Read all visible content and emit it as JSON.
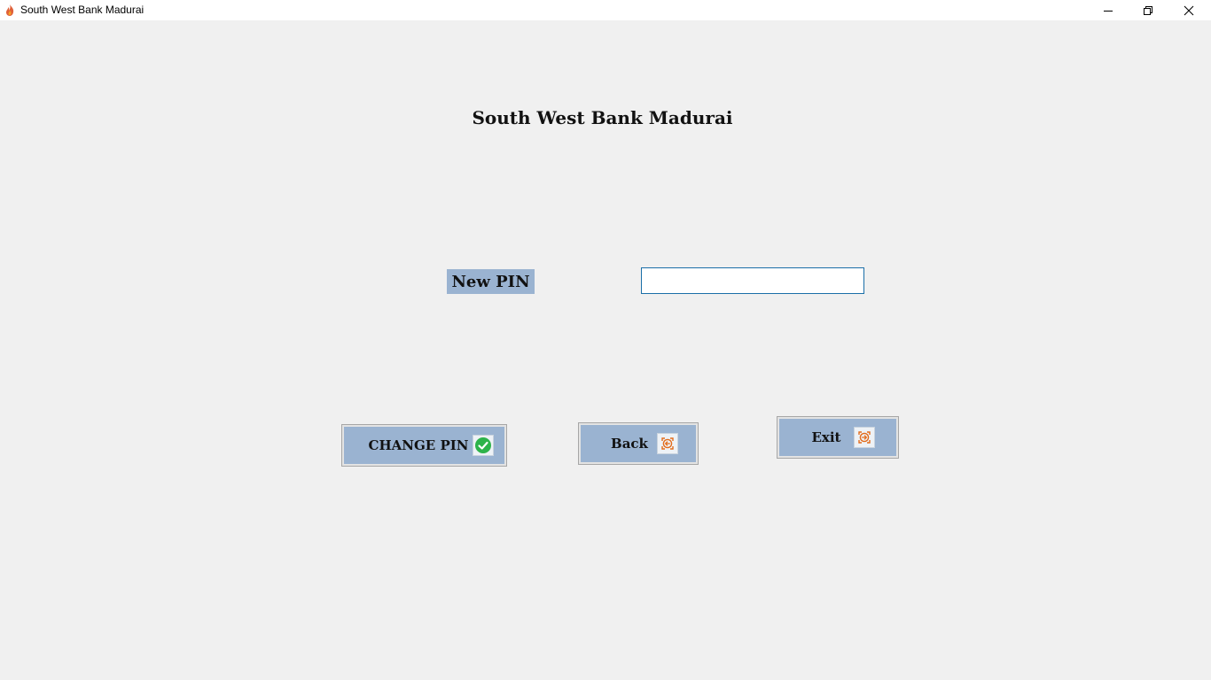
{
  "window": {
    "title": "South West Bank Madurai",
    "app_icon": "flame-app-icon",
    "controls": [
      "minimize-icon",
      "restore-icon",
      "close-icon"
    ]
  },
  "main": {
    "heading": "South West Bank Madurai",
    "new_pin_label": "New PIN",
    "new_pin_value": ""
  },
  "buttons": {
    "change_pin": {
      "label": "CHANGE PIN",
      "icon": "check-icon"
    },
    "back": {
      "label": "Back",
      "icon": "back-arrow-icon"
    },
    "exit": {
      "label": "Exit",
      "icon": "exit-arrow-icon"
    }
  },
  "colors": {
    "button_fill": "#9ab3d1",
    "label_fill": "#9ab3d1",
    "input_border": "#1b6fa8",
    "check_green": "#2db34a",
    "arrow_orange": "#e36c1c"
  }
}
